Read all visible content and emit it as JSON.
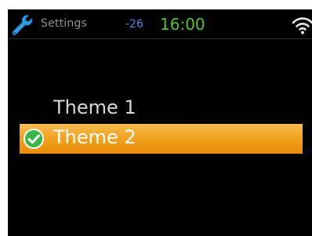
{
  "status_bar": {
    "app_title": "Settings",
    "app_icon": "wrench-icon",
    "signal_value": "-26",
    "time": "16:00",
    "wifi_icon": "wifi-icon"
  },
  "themes": {
    "items": [
      {
        "label": "Theme 1",
        "selected": false
      },
      {
        "label": "Theme 2",
        "selected": true,
        "icon": "check-icon"
      }
    ]
  },
  "colors": {
    "background": "#000000",
    "accent_blue": "#3f8fe0",
    "clock_green": "#56c23c",
    "selection_orange": "#f2a420",
    "check_green": "#3cb54a"
  }
}
